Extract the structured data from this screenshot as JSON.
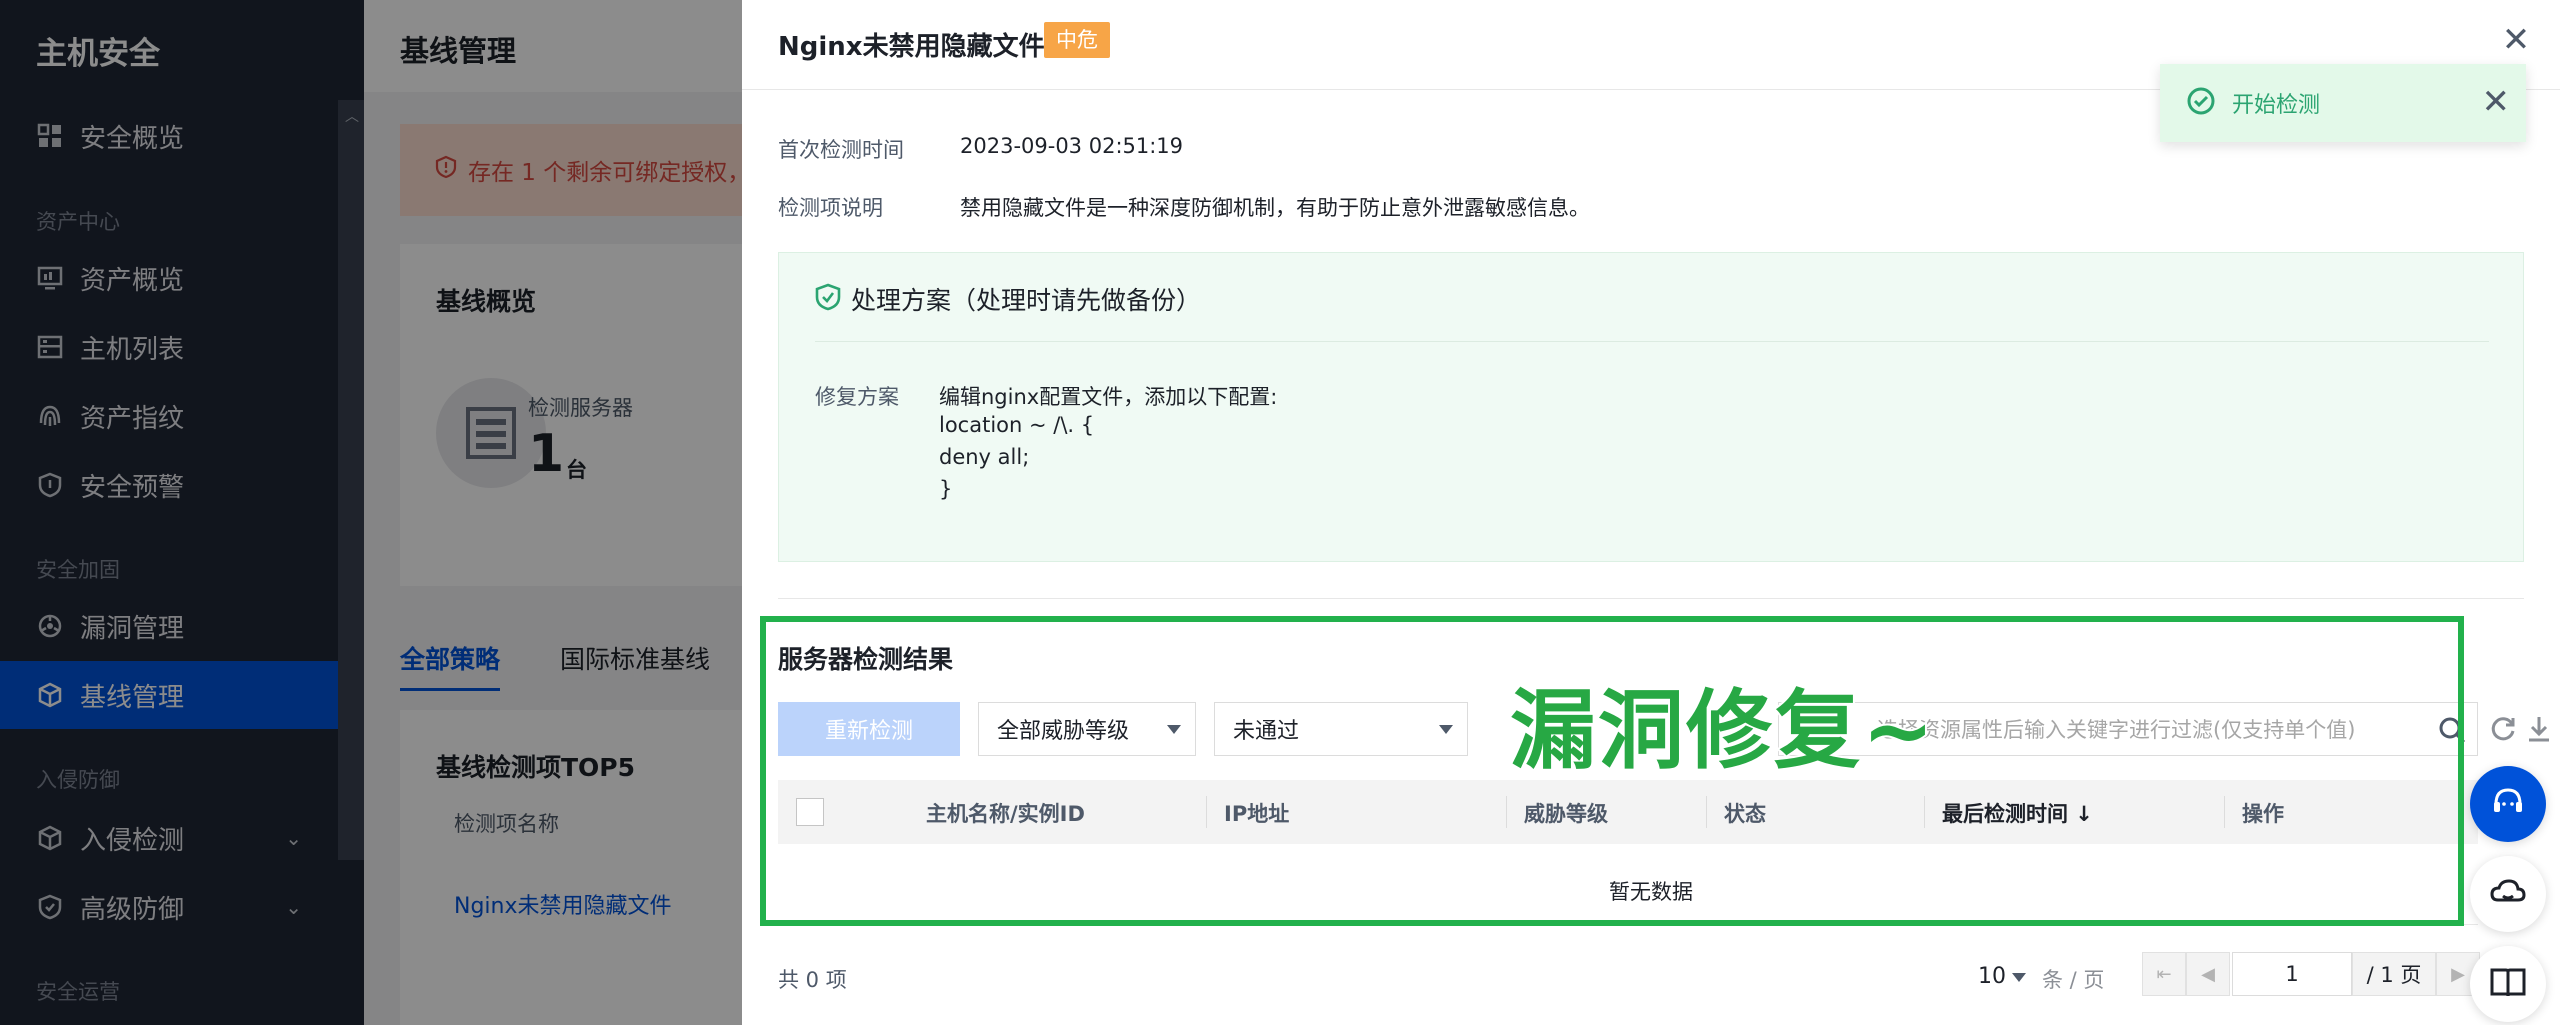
{
  "sidebar": {
    "title": "主机安全",
    "items": [
      {
        "label": "安全概览",
        "icon": "dashboard-icon"
      },
      {
        "label": "资产概览",
        "icon": "monitor-icon"
      },
      {
        "label": "主机列表",
        "icon": "list-icon"
      },
      {
        "label": "资产指纹",
        "icon": "fingerprint-icon"
      },
      {
        "label": "安全预警",
        "icon": "shield-icon"
      },
      {
        "label": "漏洞管理",
        "icon": "bug-icon"
      },
      {
        "label": "基线管理",
        "icon": "cube-icon"
      },
      {
        "label": "入侵检测",
        "icon": "cube-icon"
      },
      {
        "label": "高级防御",
        "icon": "shield-icon"
      }
    ],
    "groups": [
      "资产中心",
      "安全加固",
      "入侵防御",
      "安全运营"
    ]
  },
  "main": {
    "title": "基线管理",
    "alert": "存在 1 个剩余可绑定授权，",
    "overview_title": "基线概览",
    "server_label": "检测服务器",
    "server_count": "1",
    "server_unit": "台",
    "tabs": [
      "全部策略",
      "国际标准基线"
    ],
    "top5_title": "基线检测项TOP5",
    "top5_col": "检测项名称",
    "top5_row": "Nginx未禁用隐藏文件"
  },
  "drawer": {
    "title": "Nginx未禁用隐藏文件",
    "risk": "中危",
    "first_check_label": "首次检测时间",
    "first_check_value": "2023-09-03 02:51:19",
    "desc_label": "检测项说明",
    "desc_value": "禁用隐藏文件是一种深度防御机制，有助于防止意外泄露敏感信息。",
    "fix_title": "处理方案（处理时请先做备份）",
    "fix_label": "修复方案",
    "fix_lines": [
      "编辑nginx配置文件，添加以下配置:",
      "location ~ /\\. {",
      "deny all;",
      "}"
    ],
    "result_title": "服务器检测结果",
    "recheck_button": "重新检测",
    "threat_select": "全部威胁等级",
    "status_select": "未通过",
    "search_placeholder": "选择资源属性后输入关键字进行过滤(仅支持单个值)",
    "columns": [
      "主机名称/实例ID",
      "IP地址",
      "威胁等级",
      "状态",
      "最后检测时间 ↓",
      "操作"
    ],
    "empty": "暂无数据",
    "overlay_text": "漏洞修复~",
    "total": "共 0 项",
    "page_size": "10",
    "page_unit": "条 / 页",
    "page_current": "1",
    "page_of": "/ 1 页"
  },
  "toast": {
    "text": "开始检测"
  },
  "colors": {
    "primary": "#0052d9",
    "sidebar_bg": "#1f2735",
    "risk_tag": "#f7a547",
    "success": "#2ba471",
    "highlight": "#22b14c"
  }
}
